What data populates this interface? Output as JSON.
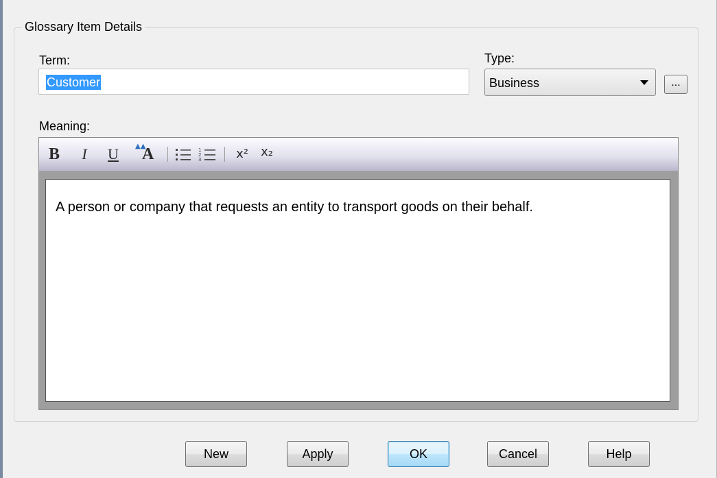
{
  "group": {
    "title": "Glossary Item Details"
  },
  "term": {
    "label": "Term:",
    "value": "Customer"
  },
  "type": {
    "label": "Type:",
    "value": "Business",
    "more_label": "..."
  },
  "meaning": {
    "label": "Meaning:",
    "text": "A person or company that requests an entity to transport goods on their behalf.",
    "toolbar": {
      "bold": "B",
      "italic": "I",
      "underline": "U",
      "font_color": "A",
      "superscript": "x²",
      "subscript": "x₂"
    }
  },
  "buttons": {
    "new": "New",
    "apply": "Apply",
    "ok": "OK",
    "cancel": "Cancel",
    "help": "Help"
  },
  "colors": {
    "selection": "#3399ff",
    "default_button_border": "#3c7fb1",
    "toolbar_bottom": "#b9b7cc"
  },
  "icons": [
    "dropdown-caret-icon",
    "bullet-list-icon",
    "numbered-list-icon",
    "font-color-icon"
  ]
}
